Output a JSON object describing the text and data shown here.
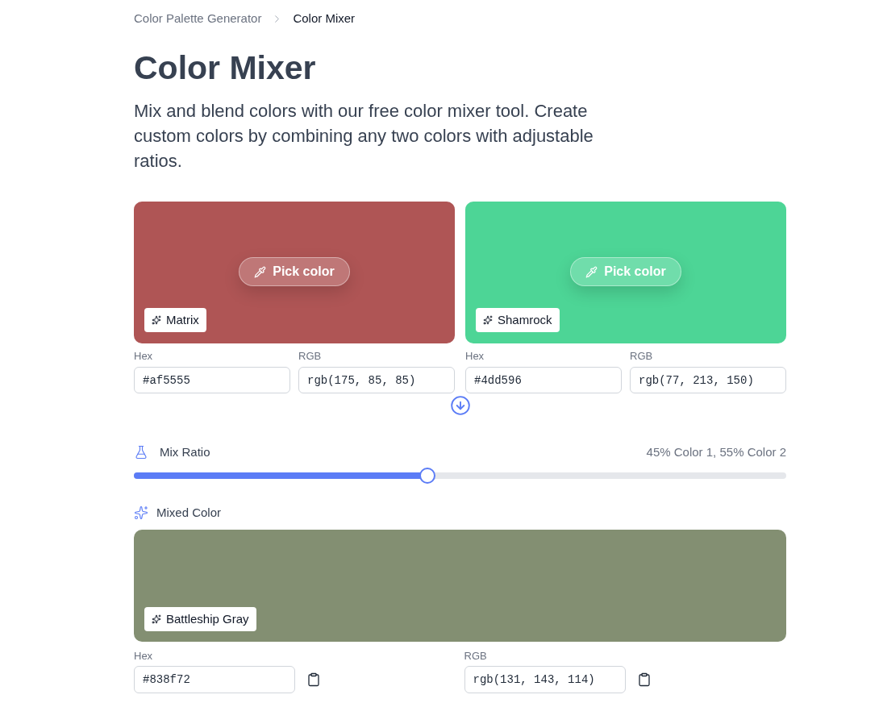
{
  "breadcrumb": [
    {
      "label": "Color Palette Generator",
      "current": false
    },
    {
      "label": "Color Mixer",
      "current": true
    }
  ],
  "title": "Color Mixer",
  "description": "Mix and blend colors with our free color mixer tool. Create custom colors by combining any two colors with adjustable ratios.",
  "colors": [
    {
      "color": "#af5555",
      "name": "Matrix",
      "pick_label": "Pick color",
      "hex_label": "Hex",
      "hex": "#af5555",
      "rgb_label": "RGB",
      "rgb": "rgb(175, 85, 85)"
    },
    {
      "color": "#4dd596",
      "name": "Shamrock",
      "pick_label": "Pick color",
      "hex_label": "Hex",
      "hex": "#4dd596",
      "rgb_label": "RGB",
      "rgb": "rgb(77, 213, 150)"
    }
  ],
  "mix_ratio": {
    "label": "Mix Ratio",
    "reading": "45% Color 1, 55% Color 2",
    "level": 0.45
  },
  "mixed": {
    "label": "Mixed Color",
    "color": "#838f72",
    "name": "Battleship Gray",
    "hex_label": "Hex",
    "hex": "#838f72",
    "rgb_label": "RGB",
    "rgb": "rgb(131, 143, 114)"
  }
}
